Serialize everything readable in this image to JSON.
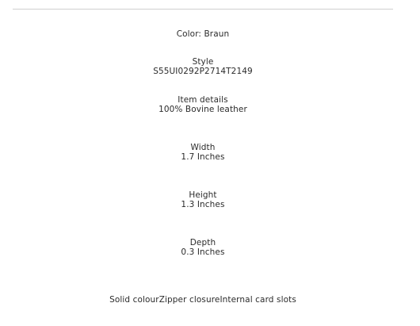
{
  "product_details": {
    "color_line": "Color: Braun",
    "style": {
      "label": "Style",
      "value": "S55UI0292P2714T2149"
    },
    "item_details": {
      "label": "Item details",
      "value": "100% Bovine leather"
    },
    "width": {
      "label": "Width",
      "value": "1.7 Inches"
    },
    "height": {
      "label": "Height",
      "value": "1.3 Inches"
    },
    "depth": {
      "label": "Depth",
      "value": "0.3 Inches"
    },
    "features_line": "Solid colourZipper closureInternal card slots"
  }
}
